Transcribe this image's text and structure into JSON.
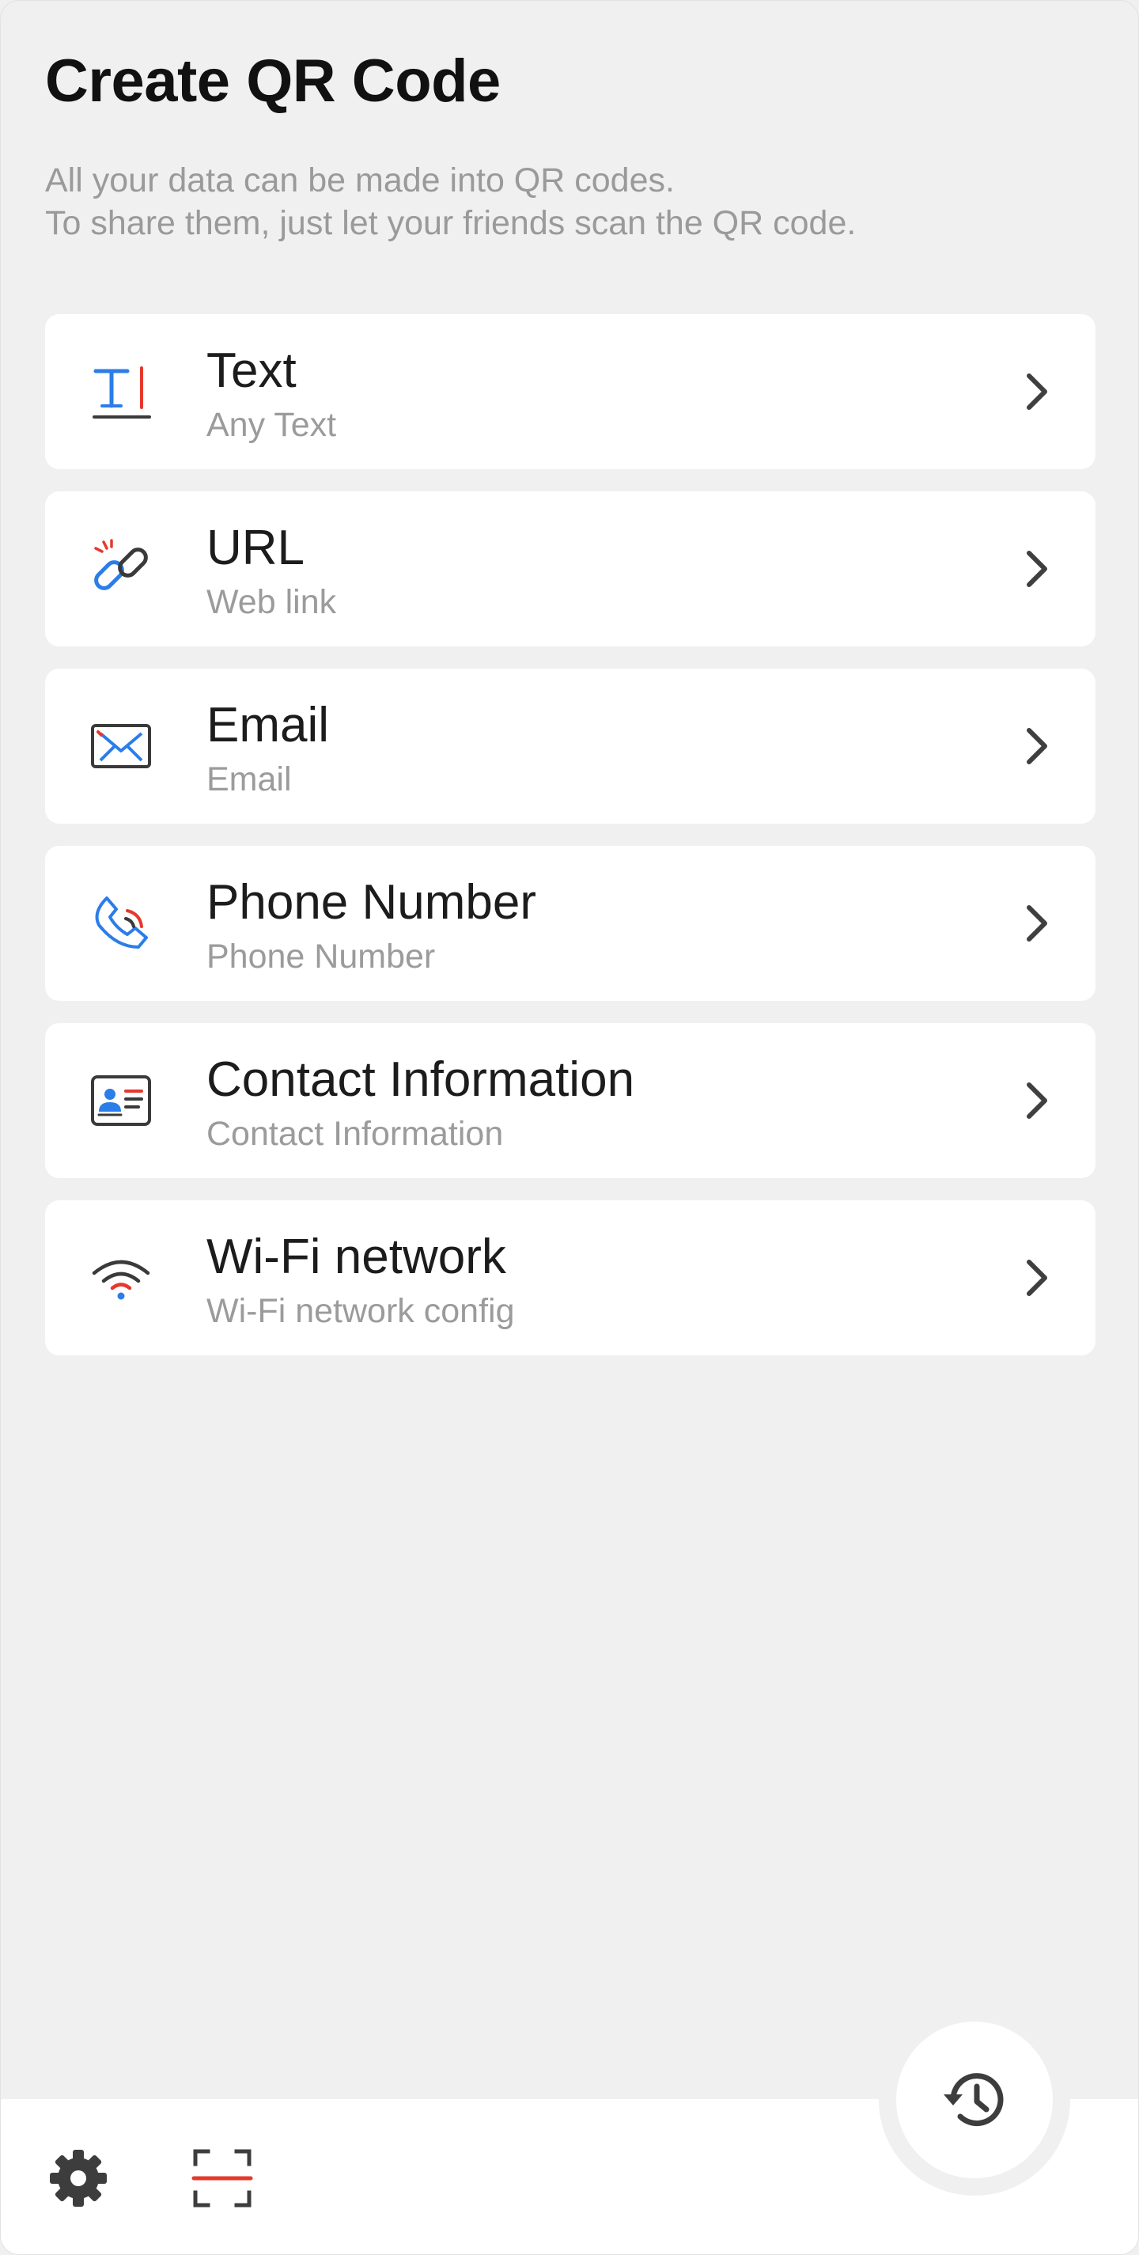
{
  "header": {
    "title": "Create QR Code",
    "description_line1": "All your data can be made into QR codes.",
    "description_line2": "To share them, just let your friends scan the QR code."
  },
  "options": [
    {
      "label": "Text",
      "sublabel": "Any Text",
      "icon": "text-icon"
    },
    {
      "label": "URL",
      "sublabel": "Web link",
      "icon": "link-icon"
    },
    {
      "label": "Email",
      "sublabel": "Email",
      "icon": "envelope-icon"
    },
    {
      "label": "Phone Number",
      "sublabel": "Phone Number",
      "icon": "phone-icon"
    },
    {
      "label": "Contact Information",
      "sublabel": "Contact Information",
      "icon": "contact-card-icon"
    },
    {
      "label": "Wi-Fi network",
      "sublabel": "Wi-Fi network config",
      "icon": "wifi-icon"
    }
  ],
  "bottom_nav": {
    "settings_icon": "gear-icon",
    "scan_icon": "scan-icon",
    "history_icon": "history-icon"
  },
  "colors": {
    "accent_blue": "#2b7de9",
    "accent_red": "#e5392d",
    "icon_dark": "#3a3a3a",
    "background": "#f0f0f0"
  }
}
